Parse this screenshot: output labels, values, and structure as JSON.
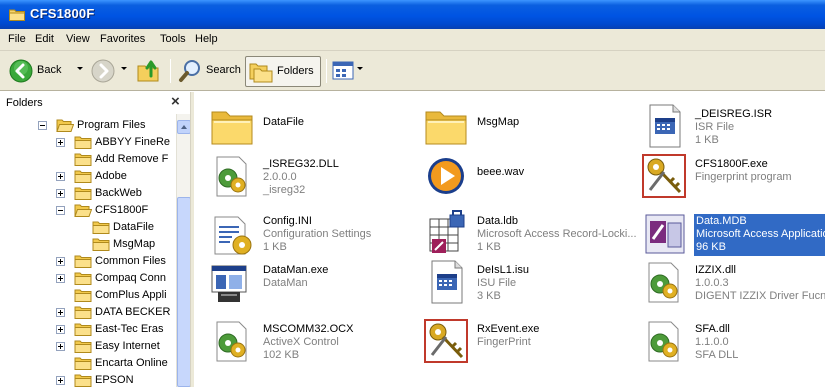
{
  "window": {
    "title": "CFS1800F"
  },
  "menu": [
    "File",
    "Edit",
    "View",
    "Favorites",
    "Tools",
    "Help"
  ],
  "toolbar": {
    "back": "Back",
    "search": "Search",
    "folders": "Folders"
  },
  "folders_pane": {
    "title": "Folders",
    "close_glyph": "×",
    "tree": [
      {
        "label": "Program Files",
        "expander": "minus"
      },
      {
        "label": "ABBYY FineRe",
        "expander": "plus"
      },
      {
        "label": "Add Remove F",
        "expander": "none"
      },
      {
        "label": "Adobe",
        "expander": "plus"
      },
      {
        "label": "BackWeb",
        "expander": "plus"
      },
      {
        "label": "CFS1800F",
        "expander": "minus"
      },
      {
        "label": "DataFile",
        "expander": "none"
      },
      {
        "label": "MsgMap",
        "expander": "none"
      },
      {
        "label": "Common Files",
        "expander": "plus"
      },
      {
        "label": "Compaq Conn",
        "expander": "plus"
      },
      {
        "label": "ComPlus Appli",
        "expander": "none"
      },
      {
        "label": "DATA BECKER",
        "expander": "plus"
      },
      {
        "label": "East-Tec Eras",
        "expander": "plus"
      },
      {
        "label": "Easy Internet",
        "expander": "plus"
      },
      {
        "label": "Encarta Online",
        "expander": "none"
      },
      {
        "label": "EPSON",
        "expander": "plus"
      }
    ]
  },
  "files": [
    {
      "name": "DataFile",
      "lines": [],
      "icon": "folder-icon"
    },
    {
      "name": "MsgMap",
      "lines": [],
      "icon": "folder-icon"
    },
    {
      "name": "_DEISREG.ISR",
      "lines": [
        "ISR File",
        "1 KB"
      ],
      "icon": "isr-file-icon"
    },
    {
      "name": "_ISREG32.DLL",
      "lines": [
        "2.0.0.0",
        "_isreg32"
      ],
      "icon": "dll-icon"
    },
    {
      "name": "beee.wav",
      "lines": [],
      "icon": "media-player-icon"
    },
    {
      "name": "CFS1800F.exe",
      "lines": [
        "Fingerprint program"
      ],
      "icon": "keys-exe-icon"
    },
    {
      "name": "Config.INI",
      "lines": [
        "Configuration Settings",
        "1 KB"
      ],
      "icon": "ini-file-icon"
    },
    {
      "name": "Data.ldb",
      "lines": [
        "Microsoft Access Record-Locki...",
        "1 KB"
      ],
      "icon": "access-lock-icon"
    },
    {
      "name": "Data.MDB",
      "lines": [
        "Microsoft Access Application",
        "96 KB"
      ],
      "icon": "access-db-icon",
      "selected": true
    },
    {
      "name": "DataMan.exe",
      "lines": [
        "DataMan"
      ],
      "icon": "app-window-icon"
    },
    {
      "name": "DeIsL1.isu",
      "lines": [
        "ISU File",
        "3 KB"
      ],
      "icon": "isu-file-icon"
    },
    {
      "name": "IZZIX.dll",
      "lines": [
        "1.0.0.3",
        "DIGENT IZZIX Driver Fucntion"
      ],
      "icon": "dll-icon"
    },
    {
      "name": "MSCOMM32.OCX",
      "lines": [
        "ActiveX Control",
        "102 KB"
      ],
      "icon": "ocx-icon"
    },
    {
      "name": "RxEvent.exe",
      "lines": [
        "FingerPrint"
      ],
      "icon": "keys-exe-icon"
    },
    {
      "name": "SFA.dll",
      "lines": [
        "1.1.0.0",
        "SFA DLL"
      ],
      "icon": "dll-icon"
    }
  ]
}
